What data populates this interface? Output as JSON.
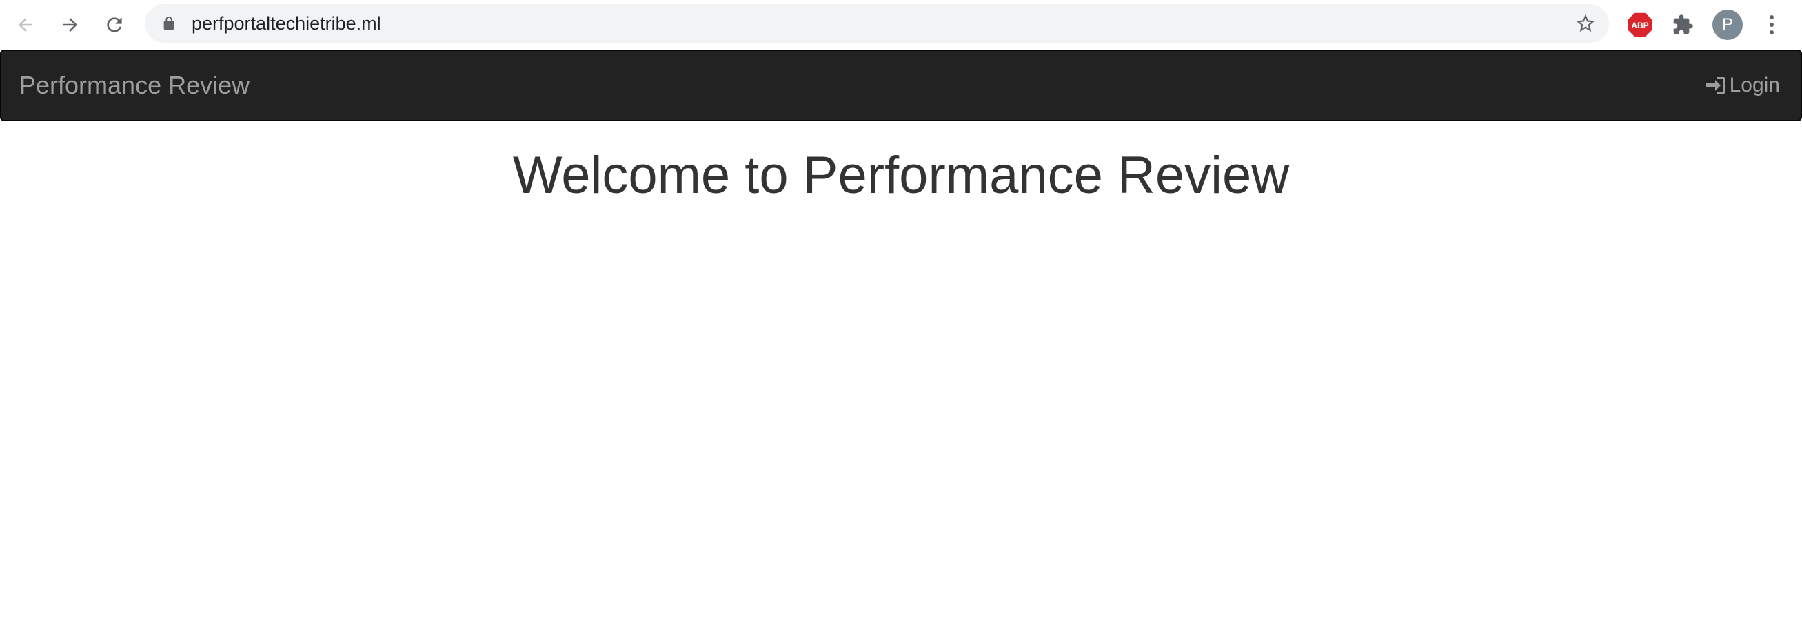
{
  "browser": {
    "url": "perfportaltechietribe.ml",
    "profile_initial": "P",
    "extension_badge": "ABP",
    "icons": {
      "back": "arrow-left-icon",
      "forward": "arrow-right-icon",
      "reload": "reload-icon",
      "lock": "lock-icon",
      "bookmark": "star-icon",
      "extensions": "puzzle-icon",
      "menu": "kebab-menu-icon"
    }
  },
  "navbar": {
    "brand": "Performance Review",
    "login_label": "Login",
    "login_icon": "sign-in-icon",
    "background": "#222222",
    "text_color": "#9d9d9d"
  },
  "main": {
    "heading": "Welcome to Performance Review",
    "heading_color": "#333333"
  }
}
